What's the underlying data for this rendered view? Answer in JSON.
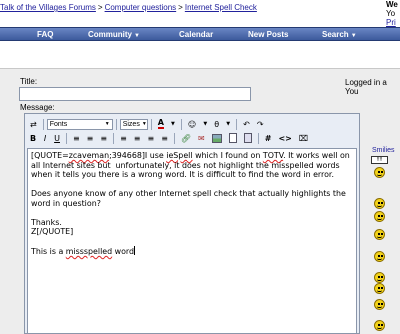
{
  "breadcrumb": {
    "items": [
      "Talk of the Villages Forums",
      "Computer questions",
      "Internet Spell Check"
    ],
    "separator": ">"
  },
  "welcome": {
    "line1": "We",
    "line2": "Yo",
    "line3": "Pri"
  },
  "navbar": {
    "items": [
      {
        "label": "FAQ",
        "dropdown": false
      },
      {
        "label": "Community",
        "dropdown": true
      },
      {
        "label": "Calendar",
        "dropdown": false
      },
      {
        "label": "New Posts",
        "dropdown": false
      },
      {
        "label": "Search",
        "dropdown": true
      }
    ]
  },
  "form": {
    "title_label": "Title:",
    "title_value": "",
    "message_label": "Message:",
    "logged_in": "Logged in a",
    "logged_in_line2": "You"
  },
  "toolbar": {
    "font_select": "Fonts",
    "size_select": "Sizes",
    "row1": [
      "A",
      "☺",
      "θ",
      "↶",
      "↷"
    ],
    "row2": [
      "B",
      "I",
      "U",
      "≡",
      "≡",
      "≡",
      "≡",
      "≡",
      "≡",
      "≡",
      "#",
      "<>",
      "⌧"
    ]
  },
  "message": {
    "paragraphs": [
      {
        "parts": [
          {
            "text": "[QUOTE="
          },
          {
            "text": "zcaveman",
            "spell": true
          },
          {
            "text": ";394668]I use "
          },
          {
            "text": "ieSpell",
            "spell": true
          },
          {
            "text": " which I found on "
          },
          {
            "text": "TOTV",
            "spell": true
          },
          {
            "text": ". It works well on all Internet sites but  unfortunately, it does not highlight the misspelled words when it tells you there is a wrong word. It is difficult to find the word in error."
          }
        ]
      },
      {
        "parts": [
          {
            "text": "Does anyone know of any other Internet spell check that actually highlights the word in question?"
          }
        ]
      },
      {
        "parts": [
          {
            "text": "Thanks.\nZ[/QUOTE]"
          }
        ]
      },
      {
        "parts": [
          {
            "text": "This is a "
          },
          {
            "text": "missspelled",
            "spell": true
          },
          {
            "text": " word"
          }
        ]
      }
    ]
  },
  "smilies": {
    "label": "Smilies",
    "bubble_text": "!!!!",
    "items": [
      "shock",
      "smile",
      "smile",
      "smile",
      "grin",
      "grin",
      "happy",
      "eek",
      "smile"
    ]
  },
  "colors": {
    "navbar_top": "#6a86c4",
    "navbar_bottom": "#3c5a9c",
    "link": "#22229c",
    "panel_bg": "#ededed",
    "spell_underline": "#d22"
  }
}
